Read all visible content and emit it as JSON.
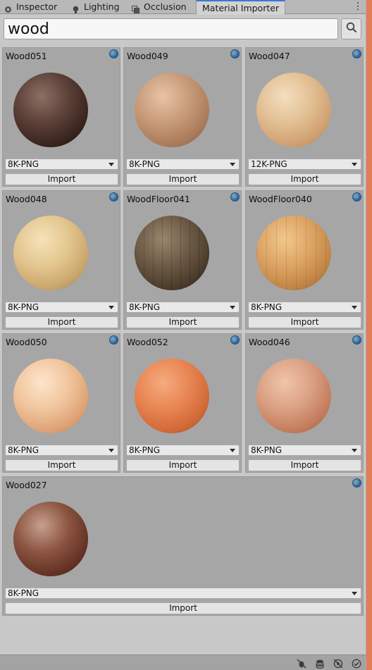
{
  "tabs": [
    {
      "label": "Inspector",
      "icon": "inspector-icon"
    },
    {
      "label": "Lighting",
      "icon": "lightbulb-icon"
    },
    {
      "label": "Occlusion",
      "icon": "occlusion-icon"
    },
    {
      "label": "Material Importer",
      "icon": null,
      "active": true
    }
  ],
  "search": {
    "value": "wood",
    "placeholder": ""
  },
  "materials": [
    {
      "name": "Wood051",
      "resolution": "8K-PNG",
      "import_label": "Import"
    },
    {
      "name": "Wood049",
      "resolution": "8K-PNG",
      "import_label": "Import"
    },
    {
      "name": "Wood047",
      "resolution": "12K-PNG",
      "import_label": "Import"
    },
    {
      "name": "Wood048",
      "resolution": "8K-PNG",
      "import_label": "Import"
    },
    {
      "name": "WoodFloor041",
      "resolution": "8K-PNG",
      "import_label": "Import"
    },
    {
      "name": "WoodFloor040",
      "resolution": "8K-PNG",
      "import_label": "Import"
    },
    {
      "name": "Wood050",
      "resolution": "8K-PNG",
      "import_label": "Import"
    },
    {
      "name": "Wood052",
      "resolution": "8K-PNG",
      "import_label": "Import"
    },
    {
      "name": "Wood046",
      "resolution": "8K-PNG",
      "import_label": "Import"
    },
    {
      "name": "Wood027",
      "resolution": "8K-PNG",
      "import_label": "Import"
    }
  ],
  "status_icons": [
    "debug-icon",
    "layers-icon",
    "eye-off-icon",
    "check-circle-icon"
  ],
  "colors": {
    "accent": "#3a79d6",
    "panel": "#a6a6a6",
    "window_edge": "#e07e57"
  }
}
